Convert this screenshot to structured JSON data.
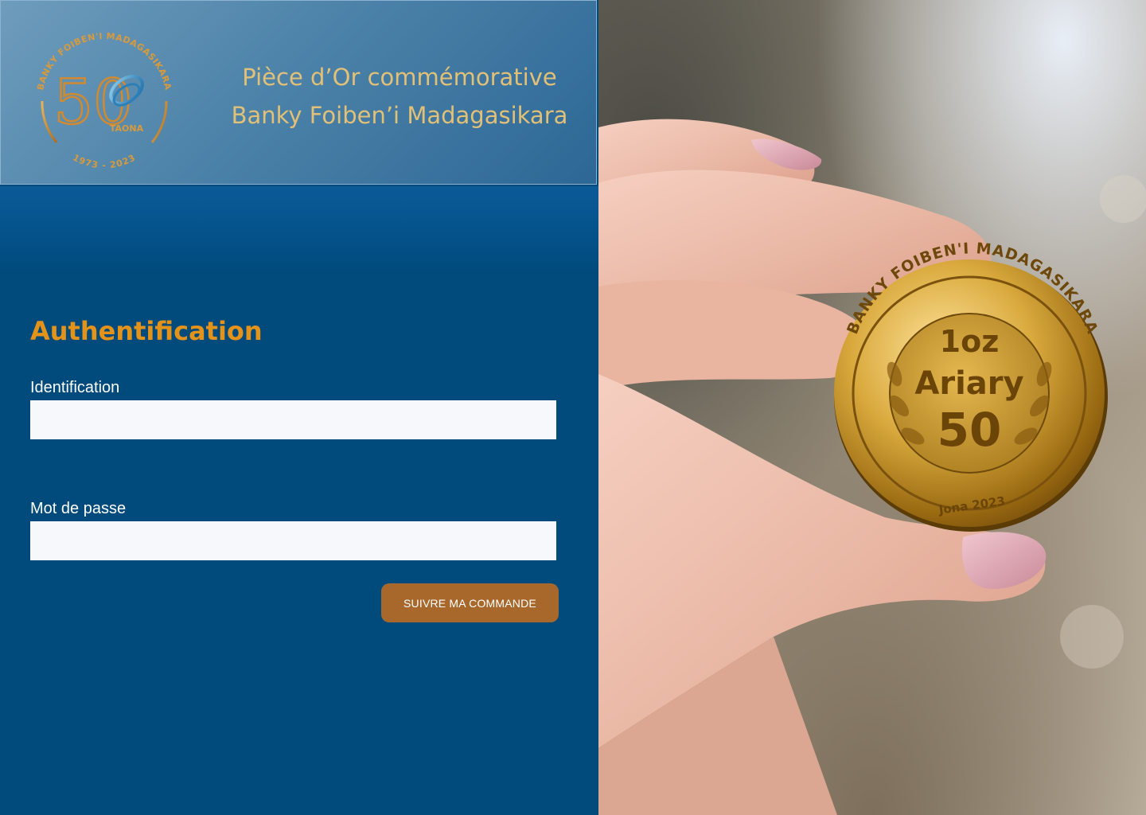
{
  "header": {
    "title_line1": "Pièce d’Or commémorative",
    "title_line2": "Banky Foiben’i Madagasikara",
    "logo": {
      "icon": "anniversary-50-logo",
      "ring_text": "BANKY FOIBEN'I MADAGASIKARA",
      "number": "50",
      "word": "TAONA",
      "years": "1973 - 2023"
    }
  },
  "form": {
    "title": "Authentification",
    "identification_label": "Identification",
    "identification_value": "",
    "password_label": "Mot de passe",
    "password_value": "",
    "submit_label": "SUIVRE MA COMMANDE"
  },
  "photo": {
    "icon": "gold-coin-photo",
    "coin_ring_text": "BANKY FOIBEN'I MADAGASIKARA",
    "coin_weight": "1oz",
    "coin_currency": "Ariary",
    "coin_value": "50",
    "coin_date": "Jona 2023"
  },
  "colors": {
    "panel_bg": "#004a7c",
    "accent_gold": "#e3921a",
    "header_text": "#e1c077",
    "button_bg": "#a8682c"
  }
}
